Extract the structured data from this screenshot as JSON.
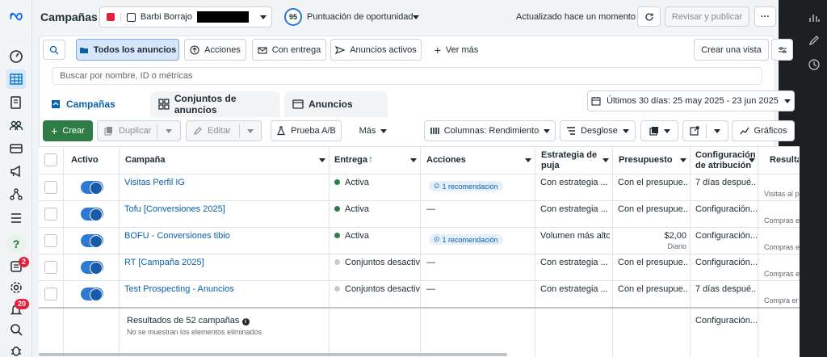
{
  "header": {
    "title": "Campañas",
    "account_name": "Barbi Borrajo",
    "opportunity_score": "95",
    "opportunity_label": "Puntuación de oportunidad",
    "updated_label": "Actualizado hace un momento",
    "review_publish": "Revisar y publicar"
  },
  "filters": {
    "all_ads": "Todos los anuncios",
    "actions": "Acciones",
    "with_delivery": "Con entrega",
    "active_ads": "Anuncios activos",
    "see_more": "Ver más",
    "create_view": "Crear una vista",
    "search_placeholder": "Buscar por nombre, ID o métricas"
  },
  "tabs": {
    "campaigns": "Campañas",
    "adsets": "Conjuntos de anuncios",
    "ads": "Anuncios"
  },
  "date_range": "Últimos 30 días: 25 may 2025 - 23 jun 2025",
  "toolbar": {
    "create": "Crear",
    "duplicate": "Duplicar",
    "edit": "Editar",
    "ab_test": "Prueba A/B",
    "more": "Más",
    "columns": "Columnas: Rendimiento",
    "breakdown": "Desglose",
    "charts": "Gráficos"
  },
  "table": {
    "headers": {
      "active": "Activo",
      "campaign": "Campaña",
      "delivery": "Entrega",
      "actions": "Acciones",
      "bid_strategy_1": "Estrategia de",
      "bid_strategy_2": "puja",
      "budget": "Presupuesto",
      "attribution_1": "Configuración",
      "attribution_2": "de atribución",
      "results": "Resulta"
    },
    "rows": [
      {
        "campaign": "Visitas Perfil IG",
        "delivery": "Activa",
        "delivery_color": "#2e7d46",
        "actions": "1 recomendación",
        "bid": "Con estrategia ...",
        "budget": "Con el presupue...",
        "budget_sub": "",
        "attribution": "7 días despué...",
        "results_sub": "Visitas al p"
      },
      {
        "campaign": "Tofu [Conversiones 2025]",
        "delivery": "Activa",
        "delivery_color": "#2e7d46",
        "actions": "—",
        "bid": "Con estrategia ...",
        "budget": "Con el presupue...",
        "budget_sub": "",
        "attribution": "Configuración...",
        "results_sub": "Compras e"
      },
      {
        "campaign": "BOFU - Conversiones tibio",
        "delivery": "Activa",
        "delivery_color": "#2e7d46",
        "actions": "1 recomendación",
        "bid": "Volumen más alto",
        "budget": "$2,00",
        "budget_sub": "Diario",
        "attribution": "Configuración...",
        "results_sub": "Compras e"
      },
      {
        "campaign": "RT [Campaña 2025]",
        "delivery": "Conjuntos desactiv",
        "delivery_color": "#c8ccd0",
        "actions": "—",
        "bid": "Con estrategia ...",
        "budget": "Con el presupue...",
        "budget_sub": "",
        "attribution": "Configuración...",
        "results_sub": "Compras e"
      },
      {
        "campaign": "Test Prospecting - Anuncios",
        "delivery": "Conjuntos desactiv",
        "delivery_color": "#c8ccd0",
        "actions": "—",
        "bid": "Con estrategia ...",
        "budget": "Con el presupue...",
        "budget_sub": "",
        "attribution": "7 días despué...",
        "results_sub": "Compra er"
      }
    ],
    "footer_results": "Resultados de 52 campañas",
    "footer_note": "No se muestran los elementos eliminados",
    "footer_attribution": "Configuración..."
  },
  "badges": {
    "updates": "2",
    "notifications": "20"
  },
  "colors": {
    "accent": "#0a5fab",
    "green": "#2e7d46",
    "toggle": "#2d79d4"
  }
}
